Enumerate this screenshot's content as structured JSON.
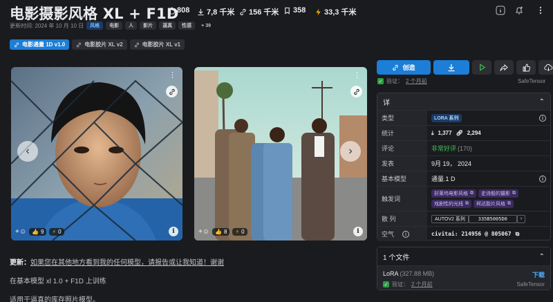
{
  "title": "电影摄影风格 XL + F1D",
  "stats": {
    "likes": "808",
    "downloads": "7,8 千米",
    "links": "156 千米",
    "bookmarks": "358",
    "buzz": "33,3 千米"
  },
  "meta": {
    "updated": "更新时间: 2024 年 10 月 10 日",
    "tags": [
      "风格",
      "电影",
      "人",
      "影片",
      "逼真",
      "性感"
    ],
    "more_tags": "+ 39"
  },
  "versions": [
    "电影通量 1D v1.0",
    "电影胶片 XL v2",
    "电影胶片 XL v1"
  ],
  "gallery": {
    "card1": {
      "likes": "9",
      "buzz": "0"
    },
    "card2": {
      "likes": "8",
      "buzz": "0"
    }
  },
  "description": {
    "line1_bold": "更新：",
    "line1_link": "如果您在其他地方看到我的任何模型，请报告或让我知道！谢谢",
    "line2": "在基本模型 xl 1.0 + F1D 上训练",
    "line3": "适用于逼真的库存照片模型。"
  },
  "actions": {
    "create": "创造"
  },
  "verified": {
    "label": "验证：",
    "time": "2 个月前",
    "safe": "SafeTensor"
  },
  "details": {
    "header": "详",
    "rows": {
      "type_label": "类型",
      "type_value": "LORA 系列",
      "stats_label": "统计",
      "stats_downloads": "1,377",
      "stats_links": "2,294",
      "reviews_label": "评论",
      "reviews_value": "非常好评",
      "reviews_count": "(170)",
      "published_label": "发表",
      "published_value": "9月 19， 2024",
      "base_label": "基本模型",
      "base_value": "通量.1 D",
      "trigger_label": "触发词",
      "triggers": [
        "好莱坞电影风格",
        "史诗般的摄影",
        "戏剧性的光线",
        "柯达胶片风格"
      ],
      "hash_label": "散 列",
      "hash_type": "AUTOV2 系列",
      "hash_value": "335B5005D0",
      "air_label": "空气",
      "air_value": "civitai: 214956 @ 805067"
    }
  },
  "files": {
    "header": "1 个文件",
    "name": "LoRA",
    "size": "(327.88 MB)",
    "download": "下载",
    "verified_label": "验证：",
    "verified_time": "2 个月前",
    "safe": "SafeTensor"
  },
  "colors": {
    "accent": "#1c7ed6",
    "background": "#1a1b1e",
    "positive": "#40c057",
    "buzz": "#fab005"
  }
}
